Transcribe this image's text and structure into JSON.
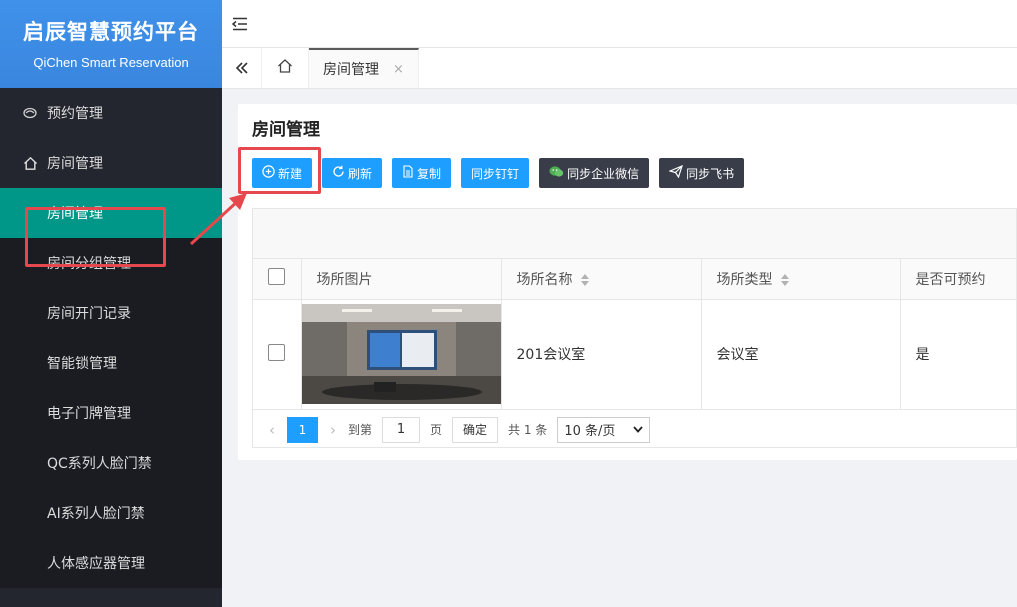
{
  "brand": {
    "title": "启辰智慧预约平台",
    "subtitle": "QiChen Smart Reservation"
  },
  "sidebar": {
    "items": [
      {
        "label": "预约管理",
        "icon": "reservation-icon"
      },
      {
        "label": "房间管理",
        "icon": "home-icon"
      }
    ],
    "sub_items": [
      "房间管理",
      "房间分组管理",
      "房间开门记录",
      "智能锁管理",
      "电子门牌管理",
      "QC系列人脸门禁",
      "AI系列人脸门禁",
      "人体感应器管理"
    ],
    "active": "房间管理"
  },
  "tabs": {
    "active_label": "房间管理",
    "close": "×"
  },
  "page": {
    "title": "房间管理"
  },
  "toolbar": {
    "new": "新建",
    "refresh": "刷新",
    "copy": "复制",
    "sync_dingtalk": "同步钉钉",
    "sync_wecom": "同步企业微信",
    "sync_feishu": "同步飞书"
  },
  "table": {
    "headers": [
      "场所图片",
      "场所名称",
      "场所类型",
      "是否可预约"
    ],
    "rows": [
      {
        "name": "201会议室",
        "type": "会议室",
        "bookable": "是"
      }
    ]
  },
  "pagination": {
    "current": "1",
    "goto_label": "到第",
    "goto_value": "1",
    "page_unit": "页",
    "confirm": "确定",
    "total": "共 1 条",
    "page_size": "10 条/页"
  },
  "colors": {
    "primary": "#1e9fff",
    "active_menu": "#009688",
    "sidebar": "#23262e",
    "highlight": "#e5484d"
  }
}
